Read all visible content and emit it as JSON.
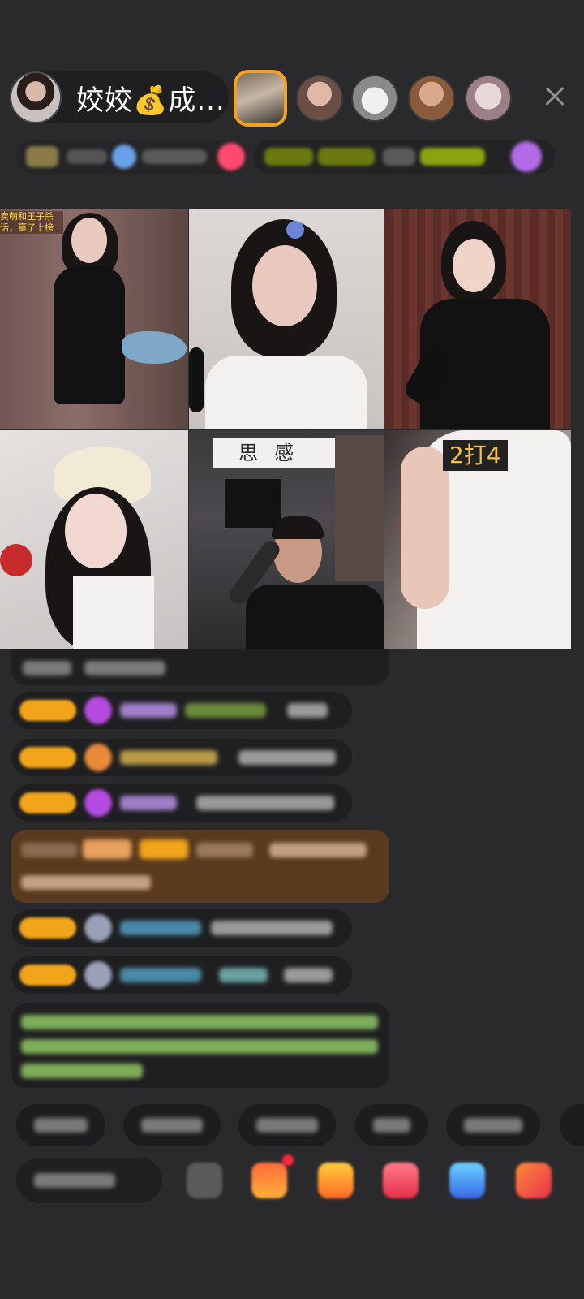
{
  "header": {
    "host_name": "姣姣💰成..."
  },
  "grid": {
    "tile6_label": "2打4",
    "tile5_sign": "思感",
    "tile1_tag": "卖萌和王子杀 话，赢了上榜"
  },
  "icons": {
    "close": "close-icon",
    "gift": "gift-icon",
    "share": "share-icon"
  },
  "colors": {
    "accent": "#f2a51a",
    "background": "#2a2a2c",
    "label_yellow": "#f7c04b"
  }
}
